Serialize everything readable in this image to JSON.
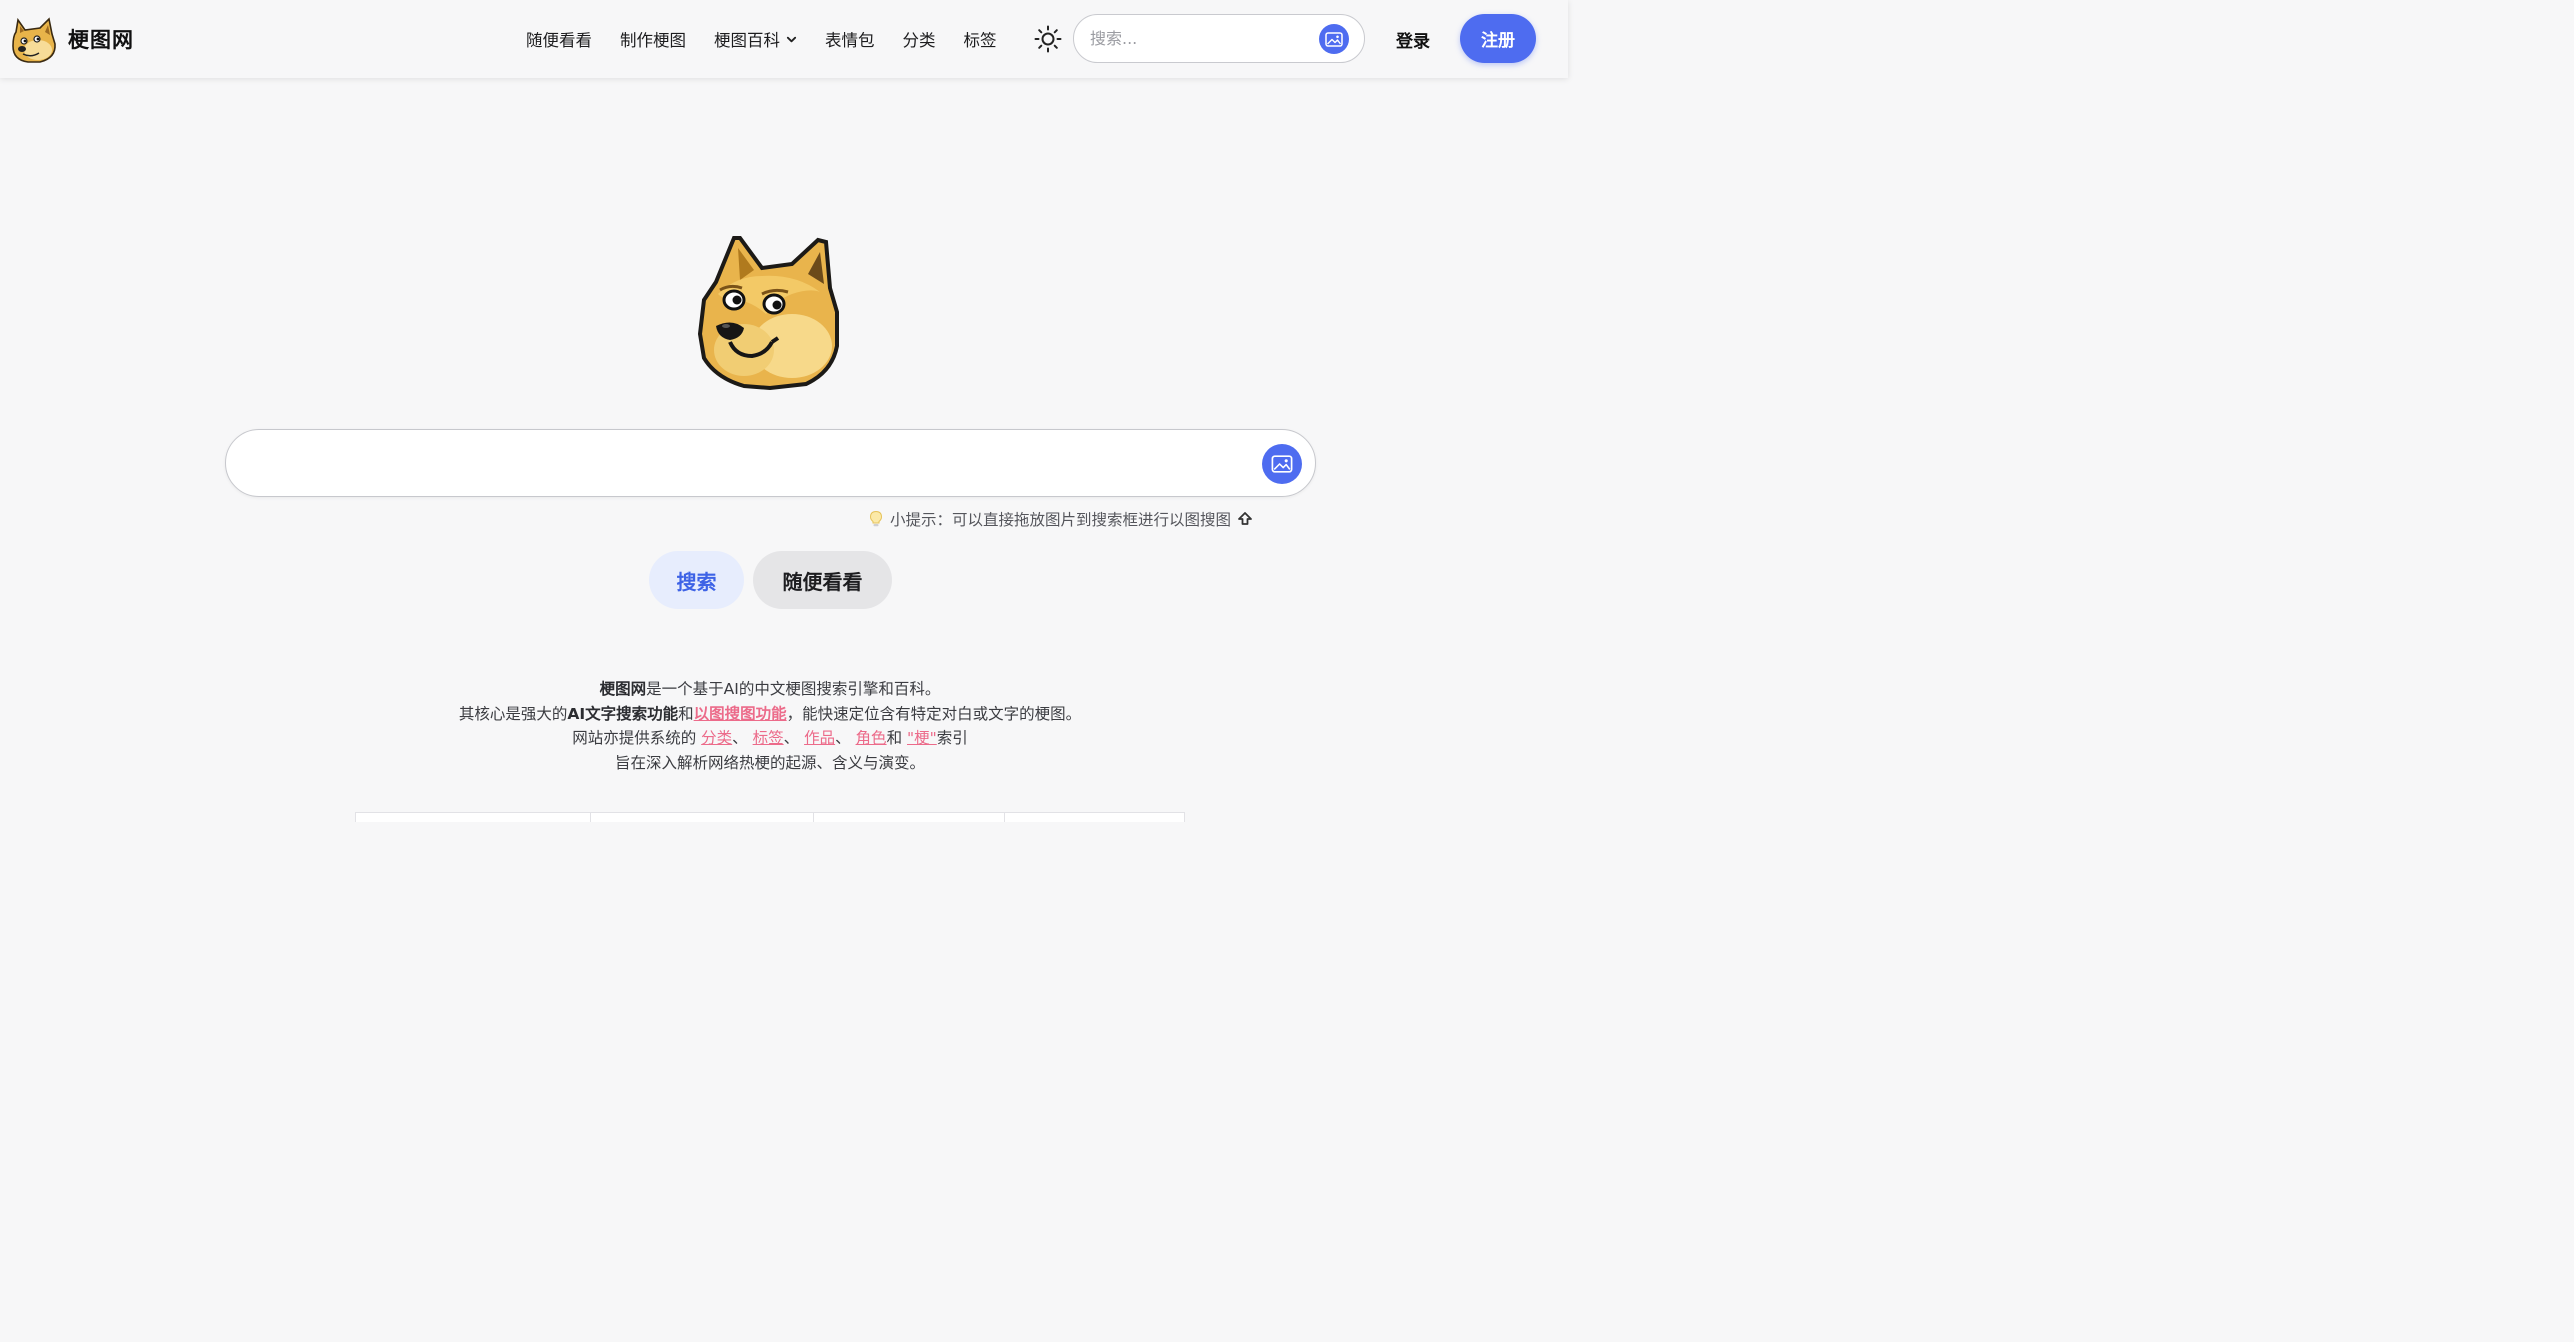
{
  "header": {
    "site_name": "梗图网",
    "nav": [
      {
        "label": "随便看看",
        "has_dropdown": false
      },
      {
        "label": "制作梗图",
        "has_dropdown": false
      },
      {
        "label": "梗图百科",
        "has_dropdown": true
      },
      {
        "label": "表情包",
        "has_dropdown": false
      },
      {
        "label": "分类",
        "has_dropdown": false
      },
      {
        "label": "标签",
        "has_dropdown": false
      }
    ],
    "search_placeholder": "搜索...",
    "login_label": "登录",
    "register_label": "注册"
  },
  "hero": {
    "search_value": "",
    "tip_text": "小提示：可以直接拖放图片到搜索框进行以图搜图",
    "search_button": "搜索",
    "random_button": "随便看看"
  },
  "description": {
    "line1": {
      "bold": "梗图网",
      "rest": "是一个基于AI的中文梗图搜索引擎和百科。"
    },
    "line2": {
      "prefix": "其核心是强大的",
      "bold": "AI文字搜索功能",
      "and": "和",
      "link": "以图搜图功能",
      "suffix": "，能快速定位含有特定对白或文字的梗图。"
    },
    "line3": {
      "prefix": "网站亦提供系统的 ",
      "links": [
        "分类",
        "标签",
        "作品",
        "角色"
      ],
      "sep": "、",
      "and": "和 ",
      "last_link": "\"梗\"",
      "suffix": "索引"
    },
    "line4": "旨在深入解析网络热梗的起源、含义与演变。"
  },
  "colors": {
    "accent": "#4e6cf0",
    "link": "#ec6b8a",
    "background": "#f7f7f8"
  },
  "icons": {
    "logo": "doge-icon",
    "theme": "sun-icon",
    "image_search": "image-icon",
    "tip": "lightbulb-icon",
    "upload": "upload-arrow-icon"
  }
}
